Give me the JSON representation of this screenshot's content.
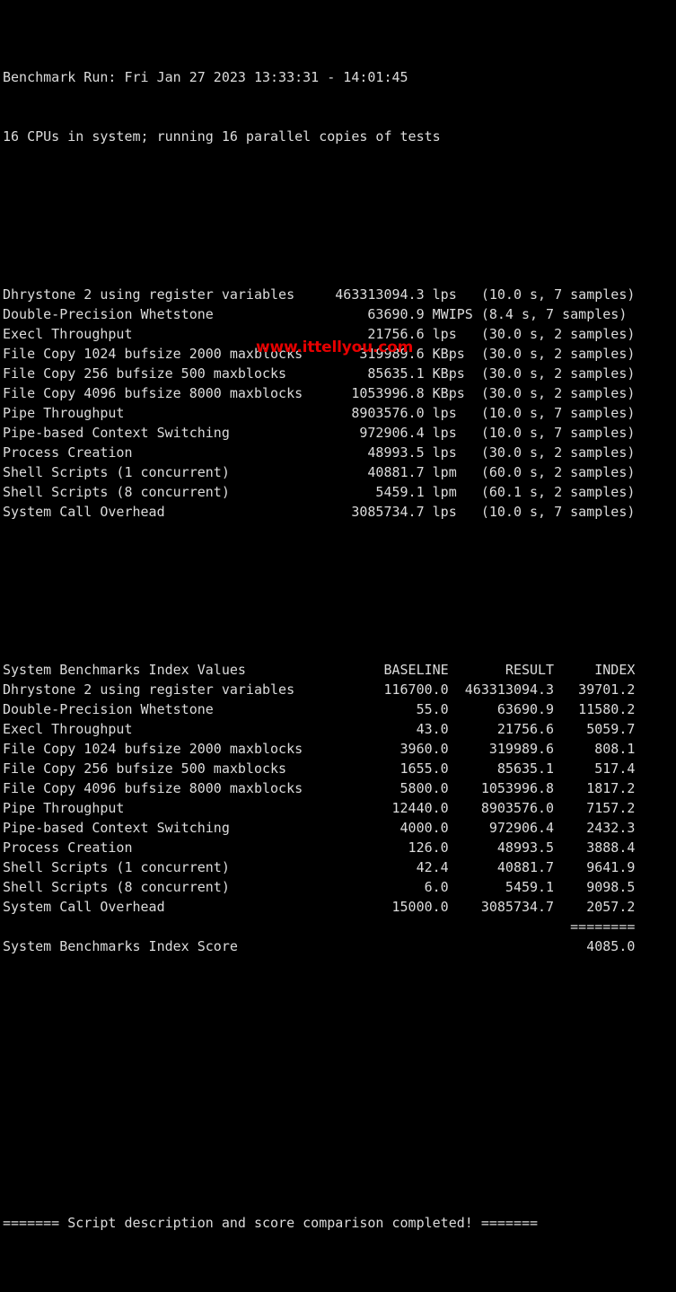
{
  "terminal": {
    "background_color": "#000000",
    "text_color": "#dcdcdc",
    "header": {
      "run_line": "Benchmark Run: Fri Jan 27 2023 13:33:31 - 14:01:45",
      "cpu_line": "16 CPUs in system; running 16 parallel copies of tests"
    },
    "raw_results": [
      {
        "name": "Dhrystone 2 using register variables",
        "value": "463313094.3",
        "unit": "lps",
        "timing": "(10.0 s, 7 samples)"
      },
      {
        "name": "Double-Precision Whetstone",
        "value": "63690.9",
        "unit": "MWIPS",
        "timing": "(8.4 s, 7 samples)"
      },
      {
        "name": "Execl Throughput",
        "value": "21756.6",
        "unit": "lps",
        "timing": "(30.0 s, 2 samples)"
      },
      {
        "name": "File Copy 1024 bufsize 2000 maxblocks",
        "value": "319989.6",
        "unit": "KBps",
        "timing": "(30.0 s, 2 samples)"
      },
      {
        "name": "File Copy 256 bufsize 500 maxblocks",
        "value": "85635.1",
        "unit": "KBps",
        "timing": "(30.0 s, 2 samples)"
      },
      {
        "name": "File Copy 4096 bufsize 8000 maxblocks",
        "value": "1053996.8",
        "unit": "KBps",
        "timing": "(30.0 s, 2 samples)"
      },
      {
        "name": "Pipe Throughput",
        "value": "8903576.0",
        "unit": "lps",
        "timing": "(10.0 s, 7 samples)"
      },
      {
        "name": "Pipe-based Context Switching",
        "value": "972906.4",
        "unit": "lps",
        "timing": "(10.0 s, 7 samples)"
      },
      {
        "name": "Process Creation",
        "value": "48993.5",
        "unit": "lps",
        "timing": "(30.0 s, 2 samples)"
      },
      {
        "name": "Shell Scripts (1 concurrent)",
        "value": "40881.7",
        "unit": "lpm",
        "timing": "(60.0 s, 2 samples)"
      },
      {
        "name": "Shell Scripts (8 concurrent)",
        "value": "5459.1",
        "unit": "lpm",
        "timing": "(60.1 s, 2 samples)"
      },
      {
        "name": "System Call Overhead",
        "value": "3085734.7",
        "unit": "lps",
        "timing": "(10.0 s, 7 samples)"
      }
    ],
    "index_section": {
      "title": "System Benchmarks Index Values",
      "columns": [
        "BASELINE",
        "RESULT",
        "INDEX"
      ],
      "rows": [
        {
          "name": "Dhrystone 2 using register variables",
          "baseline": "116700.0",
          "result": "463313094.3",
          "index": "39701.2"
        },
        {
          "name": "Double-Precision Whetstone",
          "baseline": "55.0",
          "result": "63690.9",
          "index": "11580.2"
        },
        {
          "name": "Execl Throughput",
          "baseline": "43.0",
          "result": "21756.6",
          "index": "5059.7"
        },
        {
          "name": "File Copy 1024 bufsize 2000 maxblocks",
          "baseline": "3960.0",
          "result": "319989.6",
          "index": "808.1"
        },
        {
          "name": "File Copy 256 bufsize 500 maxblocks",
          "baseline": "1655.0",
          "result": "85635.1",
          "index": "517.4"
        },
        {
          "name": "File Copy 4096 bufsize 8000 maxblocks",
          "baseline": "5800.0",
          "result": "1053996.8",
          "index": "1817.2"
        },
        {
          "name": "Pipe Throughput",
          "baseline": "12440.0",
          "result": "8903576.0",
          "index": "7157.2"
        },
        {
          "name": "Pipe-based Context Switching",
          "baseline": "4000.0",
          "result": "972906.4",
          "index": "2432.3"
        },
        {
          "name": "Process Creation",
          "baseline": "126.0",
          "result": "48993.5",
          "index": "3888.4"
        },
        {
          "name": "Shell Scripts (1 concurrent)",
          "baseline": "42.4",
          "result": "40881.7",
          "index": "9641.9"
        },
        {
          "name": "Shell Scripts (8 concurrent)",
          "baseline": "6.0",
          "result": "5459.1",
          "index": "9098.5"
        },
        {
          "name": "System Call Overhead",
          "baseline": "15000.0",
          "result": "3085734.7",
          "index": "2057.2"
        }
      ],
      "separator": "========",
      "score_label": "System Benchmarks Index Score",
      "score_value": "4085.0"
    },
    "footer": {
      "text": "======= Script description and score comparison completed! ======="
    },
    "watermark": {
      "text": "www.ittellyou.com",
      "color": "#e60000"
    }
  }
}
